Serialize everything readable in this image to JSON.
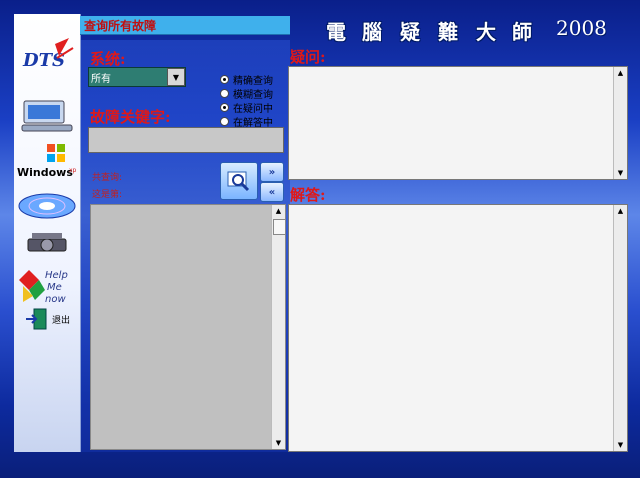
{
  "header": {
    "query_all_label": "查询所有故障",
    "title_chars": [
      "電",
      "腦",
      "疑",
      "難",
      "大",
      "師"
    ],
    "year": "2008"
  },
  "sidebar": {
    "items": [
      {
        "name": "dts-logo",
        "label": "DTS"
      },
      {
        "name": "computer",
        "label": ""
      },
      {
        "name": "windows-xp",
        "label": "Windows"
      },
      {
        "name": "disc",
        "label": ""
      },
      {
        "name": "gear-device",
        "label": ""
      },
      {
        "name": "help",
        "label": "Help Me now"
      },
      {
        "name": "exit",
        "label": "退出"
      }
    ]
  },
  "form": {
    "system_label": "系统:",
    "system_value": "所有",
    "keyword_label": "故障关键字:",
    "radios": [
      {
        "label": "精确查询",
        "checked": true
      },
      {
        "label": "模糊查询",
        "checked": false
      },
      {
        "label": "在疑问中",
        "checked": true
      },
      {
        "label": "在解答中",
        "checked": false
      }
    ],
    "total_label": "共查询:",
    "current_label": "这是第:"
  },
  "nav": {
    "next": "»",
    "prev": "«"
  },
  "panels": {
    "question_label": "疑问:",
    "answer_label": "解答:"
  }
}
